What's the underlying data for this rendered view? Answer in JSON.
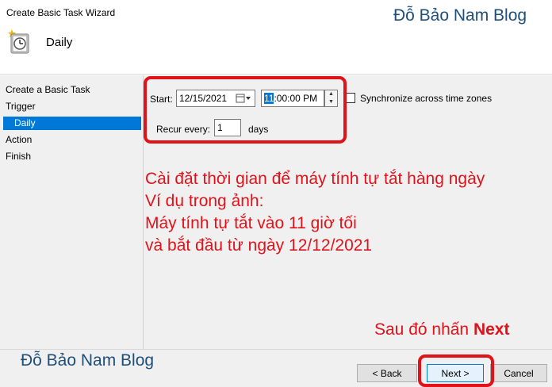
{
  "window": {
    "title": "Create Basic Task Wizard"
  },
  "watermark": "Đỗ Bảo Nam Blog",
  "header": {
    "title": "Daily",
    "icon": "task-scheduler-clock-icon"
  },
  "sidebar": {
    "items": [
      {
        "label": "Create a Basic Task",
        "indent": false,
        "active": false
      },
      {
        "label": "Trigger",
        "indent": false,
        "active": false
      },
      {
        "label": "Daily",
        "indent": true,
        "active": true
      },
      {
        "label": "Action",
        "indent": false,
        "active": false
      },
      {
        "label": "Finish",
        "indent": false,
        "active": false
      }
    ]
  },
  "form": {
    "start_label": "Start:",
    "start_date": "12/15/2021",
    "start_time_hour": "11",
    "start_time_rest": ":00:00 PM",
    "sync_label": "Synchronize across time zones",
    "sync_checked": false,
    "recur_label": "Recur every:",
    "recur_value": "1",
    "recur_unit": "days"
  },
  "annotation": {
    "lines": [
      "Cài đặt thời gian để máy tính tự tắt hàng ngày",
      "Ví dụ trong ảnh:",
      "Máy tính tự tắt vào 11 giờ tối",
      "và bắt đầu từ ngày 12/12/2021"
    ],
    "next_note_prefix": "Sau đó nhấn ",
    "next_note_bold": "Next",
    "color": "#e0121a"
  },
  "buttons": {
    "back": "< Back",
    "next": "Next >",
    "cancel": "Cancel"
  }
}
